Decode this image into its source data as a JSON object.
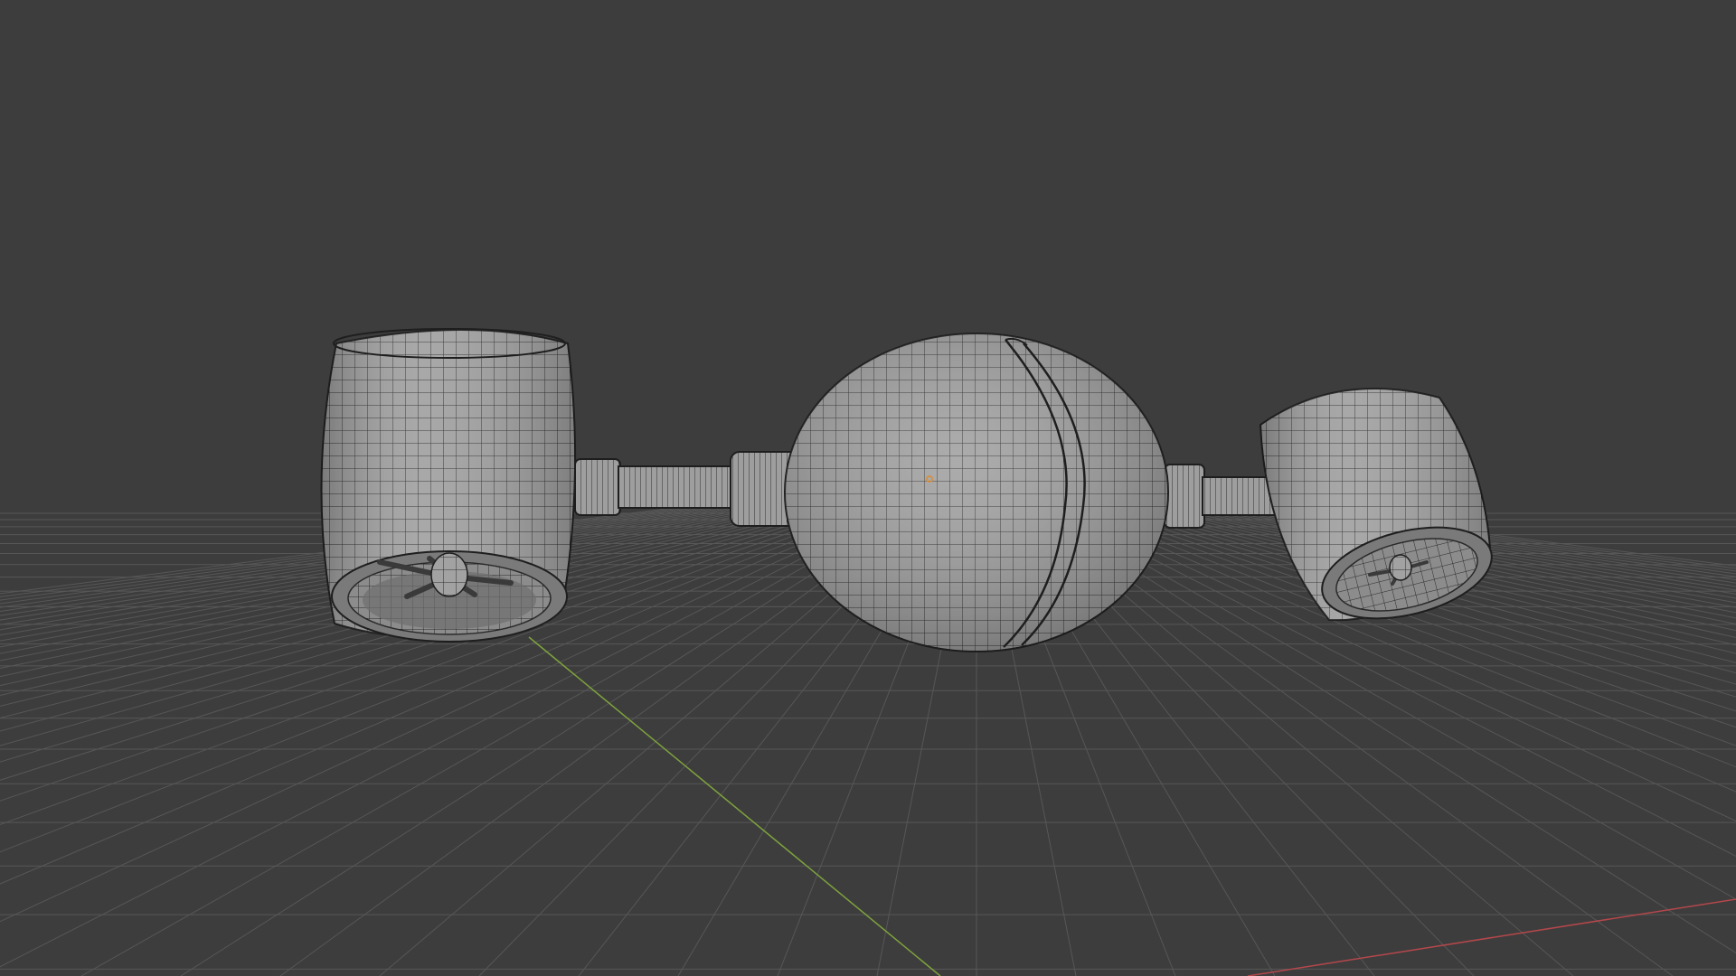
{
  "viewport": {
    "background_color": "#3d3d3d",
    "grid_color": "#575757",
    "x_axis_color": "#b5474b",
    "y_axis_color": "#7ea33d",
    "mesh_fill_color": "#9a9a9a",
    "mesh_wire_color": "#2a2a2a",
    "origin_color": "#e08a2a"
  },
  "scene": {
    "objects": [
      {
        "name": "left-engine-nacelle",
        "icon": "cylinder-mesh-icon"
      },
      {
        "name": "left-connector-strut",
        "icon": "cylinder-mesh-icon"
      },
      {
        "name": "central-body",
        "icon": "sphere-mesh-icon"
      },
      {
        "name": "right-connector-strut",
        "icon": "cylinder-mesh-icon"
      },
      {
        "name": "right-engine-nacelle",
        "icon": "cylinder-mesh-icon"
      }
    ]
  }
}
